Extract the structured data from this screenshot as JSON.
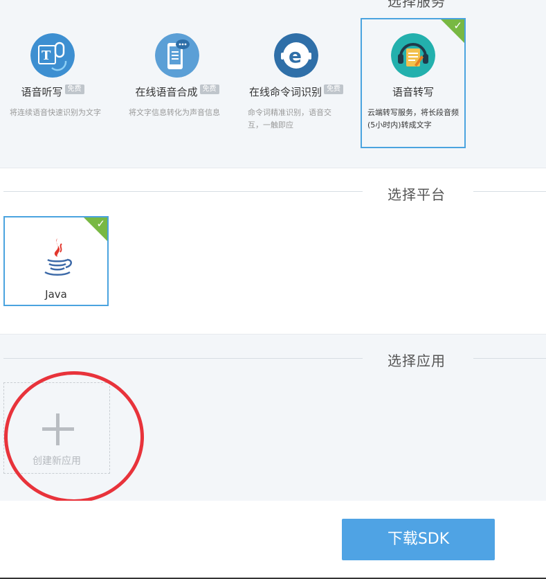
{
  "service_section": {
    "title_partial": "选择服务",
    "free_label": "免费",
    "services": [
      {
        "name": "语音听写",
        "free": true,
        "desc": "将连续语音快速识别为文字",
        "selected": false,
        "icon": "dictation-icon",
        "color": "#3d8fd1"
      },
      {
        "name": "在线语音合成",
        "free": true,
        "desc": "将文字信息转化为声音信息",
        "selected": false,
        "icon": "tts-phone-icon",
        "color": "#5b9fd6"
      },
      {
        "name": "在线命令词识别",
        "free": true,
        "desc": "命令词精准识别，语音交互，一触即应",
        "selected": false,
        "icon": "command-recognition-icon",
        "color": "#2f6fa8"
      },
      {
        "name": "语音转写",
        "free": false,
        "desc": "云端转写服务，将长段音频(5小时内)转成文字",
        "selected": true,
        "icon": "transcription-headset-icon",
        "color": "#23b0ad"
      }
    ]
  },
  "platform_section": {
    "title": "选择平台",
    "platforms": [
      {
        "name": "Java",
        "selected": true,
        "icon": "java-icon"
      }
    ]
  },
  "app_section": {
    "title": "选择应用",
    "create_label": "创建新应用"
  },
  "download_button": "下载SDK",
  "colors": {
    "accent": "#4fa3e4",
    "selected_border": "#4aa3df",
    "check_green": "#78b843",
    "annotation_red": "#e8333b"
  }
}
